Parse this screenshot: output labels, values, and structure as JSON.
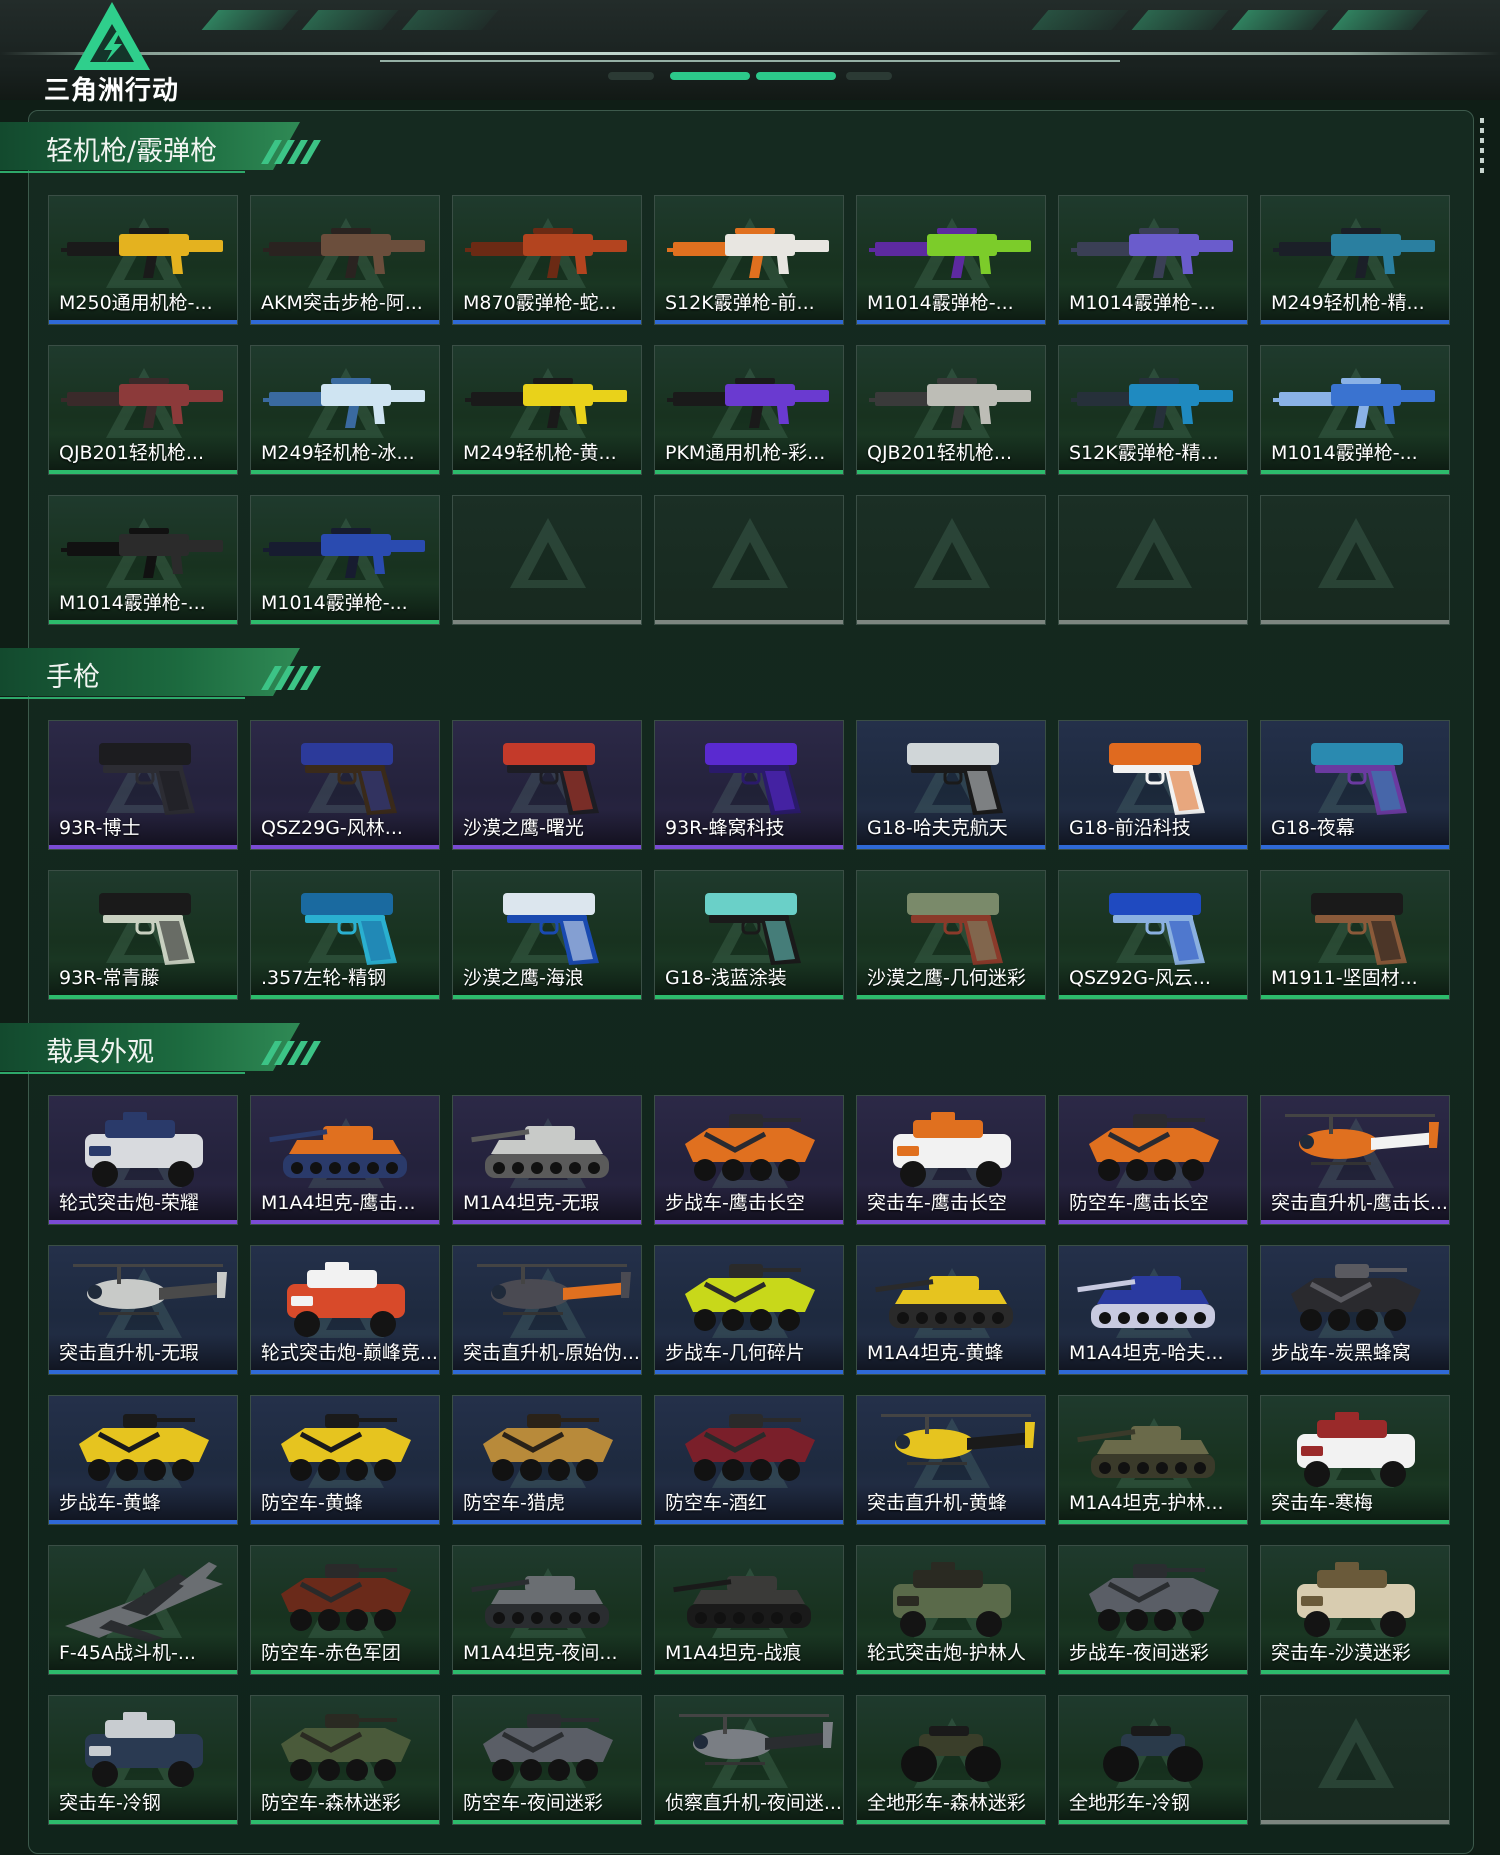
{
  "brand": {
    "name": "三角洲行动",
    "accent": "#29c986"
  },
  "sections": [
    {
      "title": "轻机枪/霰弹枪",
      "items": [
        {
          "label": "M250通用机枪-...",
          "rarity": "blue",
          "bg": "green",
          "art": "gun",
          "main": "#e4b21f",
          "sub": "#1a1a1a"
        },
        {
          "label": "AKM突击步枪-阿...",
          "rarity": "blue",
          "bg": "green",
          "art": "gun",
          "main": "#6b4e3c",
          "sub": "#2a2320"
        },
        {
          "label": "M870霰弹枪-蛇...",
          "rarity": "blue",
          "bg": "green",
          "art": "gun",
          "main": "#b3441f",
          "sub": "#6b2a14"
        },
        {
          "label": "S12K霰弹枪-前...",
          "rarity": "blue",
          "bg": "green",
          "art": "gun",
          "main": "#e8e6e1",
          "sub": "#e0701f"
        },
        {
          "label": "M1014霰弹枪-...",
          "rarity": "blue",
          "bg": "green",
          "art": "gun",
          "main": "#7ccc2a",
          "sub": "#5d2aa0"
        },
        {
          "label": "M1014霰弹枪-...",
          "rarity": "blue",
          "bg": "green",
          "art": "gun",
          "main": "#6a5ccc",
          "sub": "#3a3f55"
        },
        {
          "label": "M249轻机枪-精...",
          "rarity": "blue",
          "bg": "green",
          "art": "gun",
          "main": "#2a7fa0",
          "sub": "#1b1f28"
        },
        {
          "label": "QJB201轻机枪...",
          "rarity": "green",
          "bg": "green",
          "art": "gun",
          "main": "#8c3a3a",
          "sub": "#3a2a2a"
        },
        {
          "label": "M249轻机枪-冰...",
          "rarity": "green",
          "bg": "green",
          "art": "gun",
          "main": "#cfe4f2",
          "sub": "#3a6aa0"
        },
        {
          "label": "M249轻机枪-黄...",
          "rarity": "green",
          "bg": "green",
          "art": "gun",
          "main": "#e9d21a",
          "sub": "#1a1a1a"
        },
        {
          "label": "PKM通用机枪-彩...",
          "rarity": "green",
          "bg": "green",
          "art": "gun",
          "main": "#6a3ad0",
          "sub": "#1a1a1a"
        },
        {
          "label": "QJB201轻机枪...",
          "rarity": "green",
          "bg": "green",
          "art": "gun",
          "main": "#bdbdb6",
          "sub": "#3a3a3a"
        },
        {
          "label": "S12K霰弹枪-精...",
          "rarity": "green",
          "bg": "green",
          "art": "gun",
          "main": "#1f8ac0",
          "sub": "#26303a"
        },
        {
          "label": "M1014霰弹枪-...",
          "rarity": "green",
          "bg": "green",
          "art": "gun",
          "main": "#3a73d0",
          "sub": "#8ab2e6"
        },
        {
          "label": "M1014霰弹枪-...",
          "rarity": "green",
          "bg": "green",
          "art": "gun",
          "main": "#2b2b2b",
          "sub": "#111111"
        },
        {
          "label": "M1014霰弹枪-...",
          "rarity": "green",
          "bg": "green",
          "art": "gun",
          "main": "#2a4bb0",
          "sub": "#171c30"
        },
        {
          "label": "",
          "rarity": "gray",
          "bg": "empty",
          "art": "none"
        },
        {
          "label": "",
          "rarity": "gray",
          "bg": "empty",
          "art": "none"
        },
        {
          "label": "",
          "rarity": "gray",
          "bg": "empty",
          "art": "none"
        },
        {
          "label": "",
          "rarity": "gray",
          "bg": "empty",
          "art": "none"
        },
        {
          "label": "",
          "rarity": "gray",
          "bg": "empty",
          "art": "none"
        }
      ]
    },
    {
      "title": "手枪",
      "items": [
        {
          "label": "93R-博士",
          "rarity": "purple",
          "bg": "purple",
          "art": "pistol",
          "main": "#1c1c1f",
          "sub": "#2c2c33"
        },
        {
          "label": "QSZ29G-风林...",
          "rarity": "purple",
          "bg": "purple",
          "art": "pistol",
          "main": "#2c3a9a",
          "sub": "#3a2a1a"
        },
        {
          "label": "沙漠之鹰-曙光",
          "rarity": "purple",
          "bg": "purple",
          "art": "pistol",
          "main": "#c43a2a",
          "sub": "#1d1d24"
        },
        {
          "label": "93R-蜂窝科技",
          "rarity": "purple",
          "bg": "purple",
          "art": "pistol",
          "main": "#5a2ad0",
          "sub": "#2a1a6a"
        },
        {
          "label": "G18-哈夫克航天",
          "rarity": "blue",
          "bg": "blue",
          "art": "pistol",
          "main": "#d0d6d8",
          "sub": "#1a1a1a"
        },
        {
          "label": "G18-前沿科技",
          "rarity": "blue",
          "bg": "blue",
          "art": "pistol",
          "main": "#e06a1f",
          "sub": "#f2f2f2"
        },
        {
          "label": "G18-夜幕",
          "rarity": "blue",
          "bg": "blue",
          "art": "pistol",
          "main": "#2a8ab0",
          "sub": "#6a3aa0"
        },
        {
          "label": "93R-常青藤",
          "rarity": "green",
          "bg": "green",
          "art": "pistol",
          "main": "#1a1a1a",
          "sub": "#c8d0c0"
        },
        {
          "label": ".357左轮-精钢",
          "rarity": "green",
          "bg": "green",
          "art": "pistol",
          "main": "#1a6aa0",
          "sub": "#2ab0d0"
        },
        {
          "label": "沙漠之鹰-海浪",
          "rarity": "green",
          "bg": "green",
          "art": "pistol",
          "main": "#dce6ee",
          "sub": "#1a4ab0"
        },
        {
          "label": "G18-浅蓝涂装",
          "rarity": "green",
          "bg": "green",
          "art": "pistol",
          "main": "#6ad0c8",
          "sub": "#1a1a1a"
        },
        {
          "label": "沙漠之鹰-几何迷彩",
          "rarity": "green",
          "bg": "green",
          "art": "pistol",
          "main": "#7a8a6a",
          "sub": "#8a3a2a"
        },
        {
          "label": "QSZ92G-风云...",
          "rarity": "green",
          "bg": "green",
          "art": "pistol",
          "main": "#1f4ac0",
          "sub": "#8ab0e0"
        },
        {
          "label": "M1911-坚固材...",
          "rarity": "green",
          "bg": "green",
          "art": "pistol",
          "main": "#1a1a1a",
          "sub": "#8a5a3a"
        }
      ]
    },
    {
      "title": "载具外观",
      "items": [
        {
          "label": "轮式突击炮-荣耀",
          "rarity": "purple",
          "bg": "purple",
          "art": "truck",
          "main": "#d8dade",
          "sub": "#2a3a6a"
        },
        {
          "label": "M1A4坦克-鹰击...",
          "rarity": "purple",
          "bg": "purple",
          "art": "tank",
          "main": "#e0701f",
          "sub": "#2a3a6a"
        },
        {
          "label": "M1A4坦克-无瑕",
          "rarity": "purple",
          "bg": "purple",
          "art": "tank",
          "main": "#c8cac8",
          "sub": "#5a5a5a"
        },
        {
          "label": "步战车-鹰击长空",
          "rarity": "purple",
          "bg": "purple",
          "art": "apc",
          "main": "#e0701f",
          "sub": "#2a2a30"
        },
        {
          "label": "突击车-鹰击长空",
          "rarity": "purple",
          "bg": "purple",
          "art": "truck",
          "main": "#f2f2f2",
          "sub": "#e0701f"
        },
        {
          "label": "防空车-鹰击长空",
          "rarity": "purple",
          "bg": "purple",
          "art": "apc",
          "main": "#e0701f",
          "sub": "#2a2a30"
        },
        {
          "label": "突击直升机-鹰击长...",
          "rarity": "purple",
          "bg": "purple",
          "art": "heli",
          "main": "#e0701f",
          "sub": "#f2f2f2"
        },
        {
          "label": "突击直升机-无瑕",
          "rarity": "blue",
          "bg": "blue",
          "art": "heli",
          "main": "#c8cac8",
          "sub": "#4a4a4a"
        },
        {
          "label": "轮式突击炮-巅峰竞...",
          "rarity": "blue",
          "bg": "blue",
          "art": "truck",
          "main": "#d84a2a",
          "sub": "#f2f2f2"
        },
        {
          "label": "突击直升机-原始伪...",
          "rarity": "blue",
          "bg": "blue",
          "art": "heli",
          "main": "#4a4a52",
          "sub": "#e0701f"
        },
        {
          "label": "步战车-几何碎片",
          "rarity": "blue",
          "bg": "blue",
          "art": "apc",
          "main": "#c8d81a",
          "sub": "#2a2a2a"
        },
        {
          "label": "M1A4坦克-黄蜂",
          "rarity": "blue",
          "bg": "blue",
          "art": "tank",
          "main": "#e6c41f",
          "sub": "#2a2a2a"
        },
        {
          "label": "M1A4坦克-哈夫...",
          "rarity": "blue",
          "bg": "blue",
          "art": "tank",
          "main": "#2a3aa0",
          "sub": "#c8cae0"
        },
        {
          "label": "步战车-炭黑蜂窝",
          "rarity": "blue",
          "bg": "blue",
          "art": "apc",
          "main": "#2a2a2e",
          "sub": "#5a5a60"
        },
        {
          "label": "步战车-黄蜂",
          "rarity": "blue",
          "bg": "blue",
          "art": "apc",
          "main": "#e6c41f",
          "sub": "#1a1a1a"
        },
        {
          "label": "防空车-黄蜂",
          "rarity": "blue",
          "bg": "blue",
          "art": "apc",
          "main": "#e6c41f",
          "sub": "#1a1a1a"
        },
        {
          "label": "防空车-猎虎",
          "rarity": "blue",
          "bg": "blue",
          "art": "apc",
          "main": "#b88a3a",
          "sub": "#2a2218"
        },
        {
          "label": "防空车-酒红",
          "rarity": "blue",
          "bg": "blue",
          "art": "apc",
          "main": "#7a1f2a",
          "sub": "#2a2a2a"
        },
        {
          "label": "突击直升机-黄蜂",
          "rarity": "blue",
          "bg": "blue",
          "art": "heli",
          "main": "#e6c41f",
          "sub": "#1a1a1a"
        },
        {
          "label": "M1A4坦克-护林...",
          "rarity": "green",
          "bg": "green",
          "art": "tank",
          "main": "#6a6a4a",
          "sub": "#3a3a2a"
        },
        {
          "label": "突击车-寒梅",
          "rarity": "green",
          "bg": "green",
          "art": "truck",
          "main": "#f2f2f2",
          "sub": "#9a2a2a"
        },
        {
          "label": "F-45A战斗机-...",
          "rarity": "green",
          "bg": "green",
          "art": "jet",
          "main": "#6a6e72",
          "sub": "#2a2d30"
        },
        {
          "label": "防空车-赤色军团",
          "rarity": "green",
          "bg": "green",
          "art": "apc",
          "main": "#6a2a1a",
          "sub": "#2a2a2a"
        },
        {
          "label": "M1A4坦克-夜间...",
          "rarity": "green",
          "bg": "green",
          "art": "tank",
          "main": "#6a6e72",
          "sub": "#2a2d30"
        },
        {
          "label": "M1A4坦克-战痕",
          "rarity": "green",
          "bg": "green",
          "art": "tank",
          "main": "#3a3a38",
          "sub": "#1a1a1a"
        },
        {
          "label": "轮式突击炮-护林人",
          "rarity": "green",
          "bg": "green",
          "art": "truck",
          "main": "#5a6a4a",
          "sub": "#2a2a22"
        },
        {
          "label": "步战车-夜间迷彩",
          "rarity": "green",
          "bg": "green",
          "art": "apc",
          "main": "#5a5e66",
          "sub": "#2a2d30"
        },
        {
          "label": "突击车-沙漠迷彩",
          "rarity": "green",
          "bg": "green",
          "art": "truck",
          "main": "#d8ccb0",
          "sub": "#6a5a3a"
        },
        {
          "label": "突击车-冷钢",
          "rarity": "green",
          "bg": "green",
          "art": "truck",
          "main": "#2a3a52",
          "sub": "#c8ccd0"
        },
        {
          "label": "防空车-森林迷彩",
          "rarity": "green",
          "bg": "green",
          "art": "apc",
          "main": "#4a5a3a",
          "sub": "#2a2a22"
        },
        {
          "label": "防空车-夜间迷彩",
          "rarity": "green",
          "bg": "green",
          "art": "apc",
          "main": "#5a5e66",
          "sub": "#2a2d30"
        },
        {
          "label": "侦察直升机-夜间迷...",
          "rarity": "green",
          "bg": "green",
          "art": "heli",
          "main": "#7a7e84",
          "sub": "#2a2d30"
        },
        {
          "label": "全地形车-森林迷彩",
          "rarity": "green",
          "bg": "green",
          "art": "atv",
          "main": "#3a3e2a",
          "sub": "#1a1a1a"
        },
        {
          "label": "全地形车-冷钢",
          "rarity": "green",
          "bg": "green",
          "art": "atv",
          "main": "#2a3a4a",
          "sub": "#1a1a1a"
        },
        {
          "label": "",
          "rarity": "gray",
          "bg": "empty",
          "art": "none"
        }
      ]
    }
  ]
}
